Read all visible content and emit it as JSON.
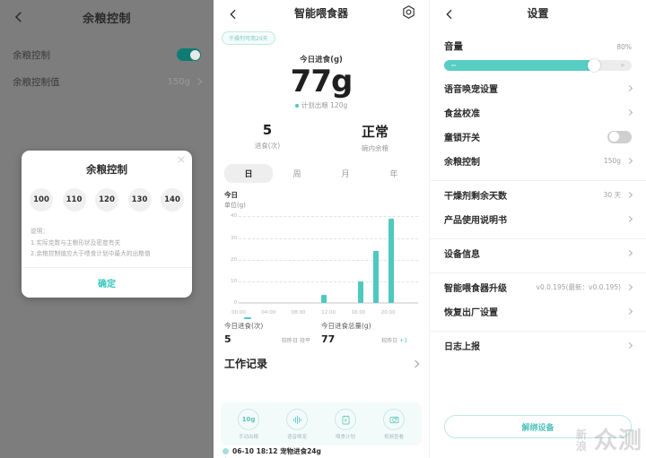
{
  "panel1": {
    "title": "余粮控制",
    "back_icon": "back-arrow-icon",
    "rows": [
      {
        "label": "余粮控制",
        "value": "",
        "control": "toggle-on"
      },
      {
        "label": "余粮控制值",
        "value": "150g",
        "control": "chevron"
      }
    ],
    "dialog": {
      "title": "余粮控制",
      "close_icon": "close-icon",
      "options": [
        "100",
        "110",
        "120",
        "130",
        "140"
      ],
      "note_title": "说明：",
      "note_lines": [
        "1.实际克数与主粮形状及密度有关",
        "2.余粮控制值应大于喂食计划中最大的出粮值"
      ],
      "confirm": "确定"
    }
  },
  "panel2": {
    "title": "智能喂食器",
    "back_icon": "back-arrow-icon",
    "gear_icon": "settings-nut-icon",
    "badge": "干燥剂可用29天",
    "headline_caption": "今日进食(g)",
    "headline_value": "77g",
    "plan_text": "计划出粮 120g",
    "stats": [
      {
        "value": "5",
        "label": "进食(次)"
      },
      {
        "value": "正常",
        "label": "碗内余粮"
      }
    ],
    "tabs": [
      "日",
      "周",
      "月",
      "年"
    ],
    "active_tab": "日",
    "chart_title": "今日",
    "chart_unit": "单位(g)",
    "summary": [
      {
        "caption": "今日进食(次)",
        "value": "5",
        "cmp_label": "较昨日",
        "cmp_value": "持平",
        "cmp_up": false
      },
      {
        "caption": "今日进食总量(g)",
        "value": "77",
        "cmp_label": "较昨日",
        "cmp_value": "+3",
        "cmp_up": true
      }
    ],
    "worklog_title": "工作记录",
    "worklog_chevron": "chevron-right-icon",
    "quick_actions": [
      {
        "icon": "grain-10g-icon",
        "glyph": "10g",
        "label": "手动出粮"
      },
      {
        "icon": "voice-wave-icon",
        "glyph": "",
        "label": "语音唤宠"
      },
      {
        "icon": "feed-plan-icon",
        "glyph": "",
        "label": "喂食计划"
      },
      {
        "icon": "video-camera-icon",
        "glyph": "",
        "label": "视频查看"
      }
    ],
    "log_entry": "06-10 18:12 宠物进食24g"
  },
  "chart_data": {
    "type": "bar",
    "title": "今日",
    "xlabel": "",
    "ylabel": "单位(g)",
    "ylim": [
      0,
      42
    ],
    "yticks": [
      0,
      10,
      20,
      30,
      40
    ],
    "xticks": [
      "00:00",
      "04:00",
      "08:00",
      "12:00",
      "16:00",
      "20:00"
    ],
    "xrange_hours": [
      0,
      24
    ],
    "grid": true,
    "legend": "none",
    "points": [
      {
        "time": "11:00",
        "hour": 11,
        "value": 4
      },
      {
        "time": "16:00",
        "hour": 16,
        "value": 10
      },
      {
        "time": "18:00",
        "hour": 18,
        "value": 24
      },
      {
        "time": "20:00",
        "hour": 20,
        "value": 39
      }
    ]
  },
  "panel3": {
    "title": "设置",
    "back_icon": "back-arrow-icon",
    "volume_label": "音量",
    "volume_percent": "80%",
    "volume_value": 80,
    "slider_minus": "−",
    "slider_plus": "+",
    "groups": [
      {
        "rows": [
          {
            "label": "语音唤宠设置",
            "value": "",
            "control": "chevron"
          },
          {
            "label": "食盆校准",
            "value": "",
            "control": "chevron"
          },
          {
            "label": "童锁开关",
            "value": "",
            "control": "toggle-off"
          },
          {
            "label": "余粮控制",
            "value": "150g",
            "control": "chevron"
          }
        ]
      },
      {
        "rows": [
          {
            "label": "干燥剂剩余天数",
            "value": "30 天",
            "control": "chevron"
          },
          {
            "label": "产品使用说明书",
            "value": "",
            "control": "chevron"
          }
        ]
      },
      {
        "rows": [
          {
            "label": "设备信息",
            "value": "",
            "control": "chevron"
          }
        ]
      },
      {
        "rows": [
          {
            "label": "智能喂食器升级",
            "value": "v0.0.195(最新：v0.0.195)",
            "control": "chevron"
          },
          {
            "label": "恢复出厂设置",
            "value": "",
            "control": "chevron"
          }
        ]
      },
      {
        "rows": [
          {
            "label": "日志上报",
            "value": "",
            "control": "chevron"
          }
        ]
      }
    ],
    "unbind_label": "解绑设备",
    "watermark": "众测",
    "watermark_small": "新浪"
  },
  "colors": {
    "accent": "#4ec9bf",
    "accent_dark": "#0e7c72",
    "text": "#2b2b2b",
    "muted": "#9a9a9a",
    "dim_bg": "#7d7d7d"
  }
}
